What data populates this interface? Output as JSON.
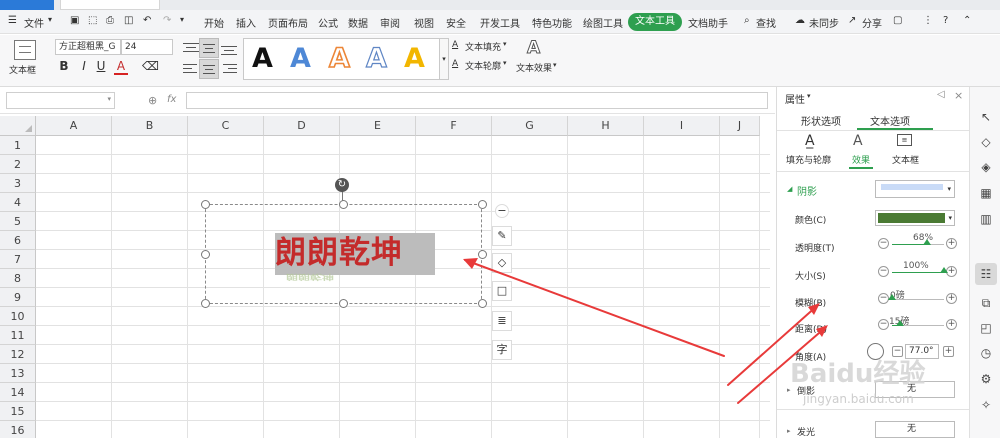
{
  "menubar": {
    "file": "文件",
    "items": [
      "开始",
      "插入",
      "页面布局",
      "公式",
      "数据",
      "审阅",
      "视图",
      "安全",
      "开发工具",
      "特色功能",
      "绘图工具"
    ],
    "active_tab": "文本工具",
    "doc_assistant": "文档助手",
    "search": "查找",
    "sync": "未同步",
    "share": "分享",
    "help": "?"
  },
  "ribbon": {
    "textbox_label": "文本框",
    "font_name": "方正超粗黑_G",
    "font_size": "24",
    "bold": "B",
    "italic": "I",
    "underline": "U",
    "font_color": "A",
    "style_glyph": "A",
    "fill": "文本填充",
    "outline": "文本轮廓",
    "effects": "文本效果"
  },
  "formula": {
    "fx": "fx"
  },
  "sheet": {
    "columns": [
      "A",
      "B",
      "C",
      "D",
      "E",
      "F",
      "G",
      "H",
      "I",
      "J"
    ],
    "rows": [
      "1",
      "2",
      "3",
      "4",
      "5",
      "6",
      "7",
      "8",
      "9",
      "10",
      "11",
      "12",
      "13",
      "14",
      "15",
      "16"
    ]
  },
  "textbox": {
    "text": "朗朗乾坤",
    "shadow_text": "朗朗乾坤"
  },
  "floatbar": {
    "textfit": "字"
  },
  "panel": {
    "title": "属性",
    "tabs": [
      "形状选项",
      "文本选项"
    ],
    "subtabs": [
      "填充与轮廓",
      "效果",
      "文本框"
    ],
    "section_shadow": "阴影",
    "color_label": "颜色(C)",
    "transparency_label": "透明度(T)",
    "transparency_value": "68%",
    "size_label": "大小(S)",
    "size_value": "100%",
    "blur_label": "模糊(B)",
    "blur_value": "0磅",
    "distance_label": "距离(D)",
    "distance_value": "15磅",
    "angle_label": "角度(A)",
    "angle_value": "77.0°",
    "reflection_label": "倒影",
    "reflection_value": "无",
    "glow_label": "发光",
    "glow_value": "无",
    "shadow_color": "#4a7a33",
    "preset_color": "#c9dbf7"
  },
  "colors": {
    "accent_green": "#2e9f4f",
    "wordart_red": "#c42b2b",
    "arrow_red": "#e83a3a"
  },
  "watermark": {
    "brand": "Baidu",
    "cn": "经验",
    "url": "jingyan.baidu.com"
  },
  "sliders": {
    "transparency": 0.68,
    "size": 1.0,
    "blur": 0.0,
    "distance": 0.15
  }
}
